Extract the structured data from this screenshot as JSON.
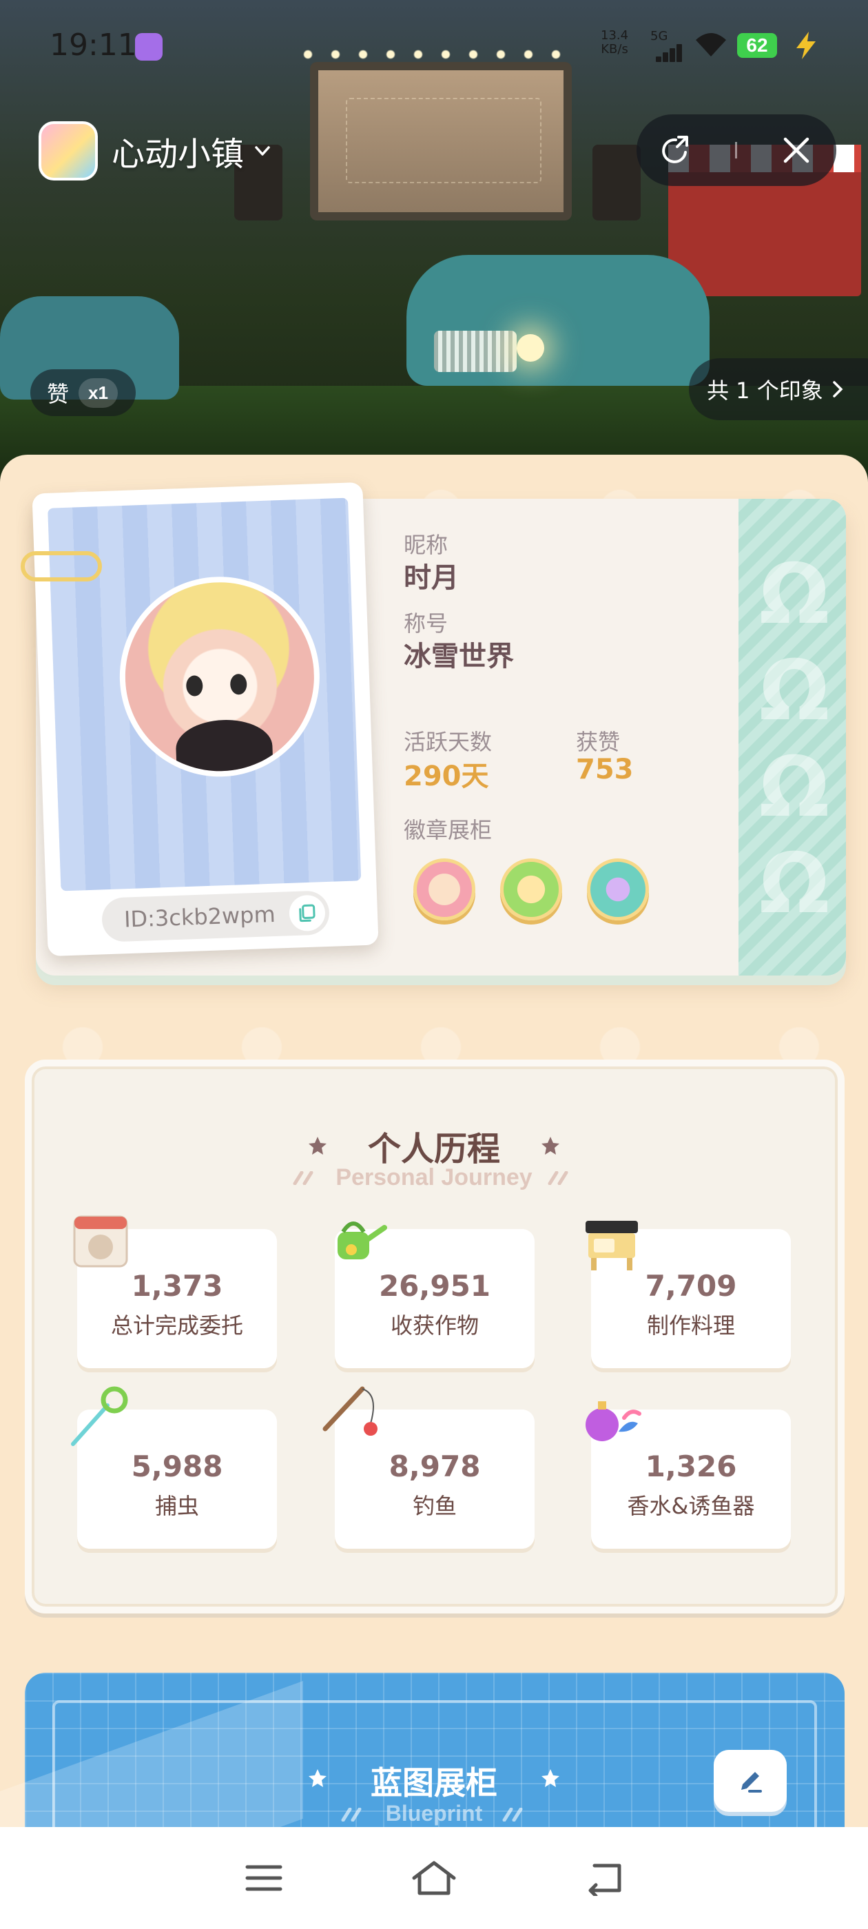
{
  "status_bar": {
    "time": "19:11",
    "net_speed": "13.4\nKB/s",
    "network": "5G",
    "battery": "62"
  },
  "header": {
    "app_name": "心动小镇",
    "icons": [
      "app-icon",
      "chevron-down-icon",
      "share-icon",
      "close-icon"
    ]
  },
  "hero": {
    "like_label": "赞",
    "like_count": "x1",
    "impressions": "共 1 个印象"
  },
  "profile": {
    "nickname_label": "昵称",
    "nickname": "时月",
    "title_label": "称号",
    "title": "冰雪世界",
    "active_days_label": "活跃天数",
    "active_days": "290天",
    "likes_label": "获赞",
    "likes": "753",
    "badges_label": "徽章展柜",
    "badges": [
      {
        "name": "cake-badge",
        "color": "#f5a3b0"
      },
      {
        "name": "frog-badge",
        "color": "#9fdc6a"
      },
      {
        "name": "bubbles-badge",
        "color": "#6ed0c0"
      }
    ],
    "id_text": "ID:3ckb2wpm"
  },
  "journey": {
    "title": "个人历程",
    "subtitle": "Personal Journey",
    "stats": [
      {
        "value": "1,373",
        "label": "总计完成委托",
        "icon": "calendar-icon"
      },
      {
        "value": "26,951",
        "label": "收获作物",
        "icon": "watering-can-icon"
      },
      {
        "value": "7,709",
        "label": "制作料理",
        "icon": "stove-icon"
      },
      {
        "value": "5,988",
        "label": "捕虫",
        "icon": "bug-net-icon"
      },
      {
        "value": "8,978",
        "label": "钓鱼",
        "icon": "fishing-rod-icon"
      },
      {
        "value": "1,326",
        "label": "香水&诱鱼器",
        "icon": "perfume-icon"
      }
    ]
  },
  "blueprint": {
    "title": "蓝图展柜",
    "subtitle": "Blueprint"
  },
  "nav": {
    "icons": [
      "menu-icon",
      "home-icon",
      "back-icon"
    ]
  },
  "colors": {
    "accent_gold": "#e3a441",
    "text_brown": "#6b4a45",
    "blueprint_blue": "#4fa3e0",
    "page_bg": "#fbe7cb"
  }
}
